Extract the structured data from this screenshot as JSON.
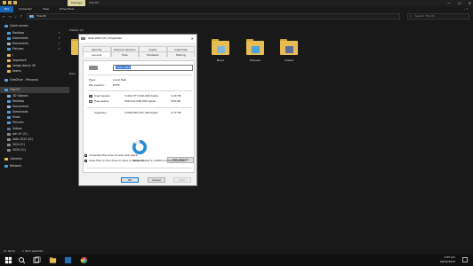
{
  "window": {
    "ribbon_context_tab": "Manage",
    "title": "This PC",
    "controls": {
      "minimize": "—",
      "maximize": "☐",
      "close": "✕"
    }
  },
  "ribbon": {
    "tabs": [
      "File",
      "Computer",
      "View",
      "Drive Tools"
    ]
  },
  "address": {
    "path": "This PC",
    "search_placeholder": "Search This PC"
  },
  "sidebar": {
    "items": [
      {
        "label": "Quick access",
        "icon": "star-icon"
      },
      {
        "label": "Desktop",
        "icon": "desktop-icon"
      },
      {
        "label": "Downloads",
        "icon": "downloads-icon"
      },
      {
        "label": "Documents",
        "icon": "documents-icon"
      },
      {
        "label": "Pictures",
        "icon": "pictures-icon"
      },
      {
        "label": "/",
        "icon": "folder-icon"
      },
      {
        "label": "important",
        "icon": "folder-icon"
      },
      {
        "label": "imngo dance 36",
        "icon": "folder-icon"
      },
      {
        "label": "teams",
        "icon": "folder-icon"
      },
      {
        "label": "OneDrive - Personal",
        "icon": "cloud-icon"
      },
      {
        "label": "This PC",
        "icon": "computer-icon"
      },
      {
        "label": "3D Objects",
        "icon": "cube-icon"
      },
      {
        "label": "Desktop",
        "icon": "desktop-icon"
      },
      {
        "label": "Documents",
        "icon": "documents-icon"
      },
      {
        "label": "Downloads",
        "icon": "downloads-icon"
      },
      {
        "label": "Music",
        "icon": "music-icon"
      },
      {
        "label": "Pictures",
        "icon": "pictures-icon"
      },
      {
        "label": "Videos",
        "icon": "videos-icon"
      },
      {
        "label": "win 10 (C:)",
        "icon": "drive-icon"
      },
      {
        "label": "data 2023 (D:)",
        "icon": "drive-icon"
      },
      {
        "label": "2024 (F:)",
        "icon": "drive-icon"
      },
      {
        "label": "2020 (G:)",
        "icon": "drive-icon"
      },
      {
        "label": "Libraries",
        "icon": "libraries-icon"
      },
      {
        "label": "Network",
        "icon": "network-icon"
      }
    ]
  },
  "main": {
    "folders_header": "Folders (7)",
    "devices_header": "Devi",
    "folders": [
      {
        "label": "",
        "overlay": ""
      },
      {
        "label": "Music",
        "overlay": "music"
      },
      {
        "label": "Pictures",
        "overlay": "pictures"
      },
      {
        "label": "Videos",
        "overlay": "videos"
      }
    ]
  },
  "dialog": {
    "title": "data 2023 (D:) Properties",
    "tabs_row1": [
      "Security",
      "Previous Versions",
      "Quota",
      "Customize"
    ],
    "tabs_row2": [
      "General",
      "Tools",
      "Hardware",
      "Sharing"
    ],
    "name_value": "data 2023",
    "type_label": "Type:",
    "type_value": "Local Disk",
    "fs_label": "File system:",
    "fs_value": "NTFS",
    "used_label": "Used space:",
    "used_bytes": "3,442,377,000,000 bytes",
    "used_size": "3.20 TB",
    "free_label": "Free space:",
    "free_bytes": "556,212,046,000 bytes",
    "free_size": "518 GB",
    "capacity_label": "Capacity:",
    "capacity_bytes": "3,000,585,297,400 bytes",
    "capacity_size": "2.72 TB",
    "drive_label": "Drive D:",
    "cleanup_label": "Disk Cleanup",
    "compress_label": "Compress this drive to save disk space",
    "index_label": "Allow files on this drive to have contents indexed in addition to file properties",
    "ok": "OK",
    "cancel": "Cancel",
    "apply": "Apply",
    "used_fraction": 0.86,
    "colors": {
      "used": "#2b8cd6",
      "free": "#e8e8e8"
    }
  },
  "status": {
    "items": "11 items",
    "selected": "1 item selected"
  },
  "taskbar": {
    "time": "1:55 pm",
    "date": "02/02/2025"
  }
}
